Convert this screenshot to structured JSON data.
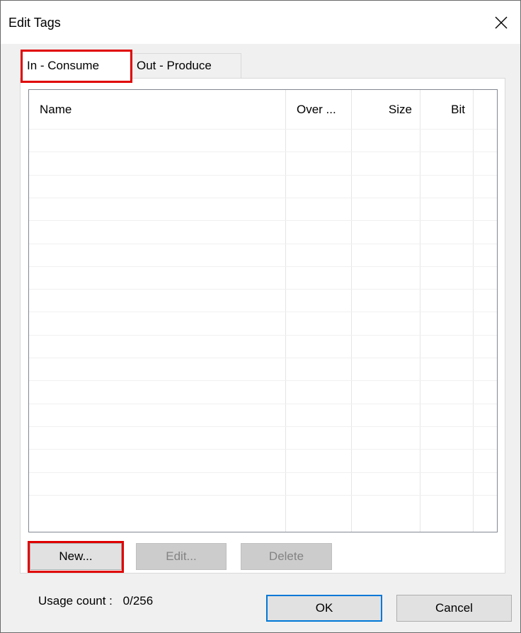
{
  "window": {
    "title": "Edit Tags",
    "close_icon": "close-icon"
  },
  "tabs": [
    {
      "label": "In - Consume",
      "active": true
    },
    {
      "label": "Out - Produce",
      "active": false
    }
  ],
  "list": {
    "columns": [
      "Name",
      "Over ...",
      "Size",
      "Bit"
    ],
    "rows": []
  },
  "buttons": {
    "new": "New...",
    "edit": "Edit...",
    "delete": "Delete",
    "ok": "OK",
    "cancel": "Cancel"
  },
  "usage": {
    "label": "Usage count :",
    "value": "0/256"
  },
  "colors": {
    "highlight": "#e00000",
    "default_button_border": "#0078d7"
  }
}
